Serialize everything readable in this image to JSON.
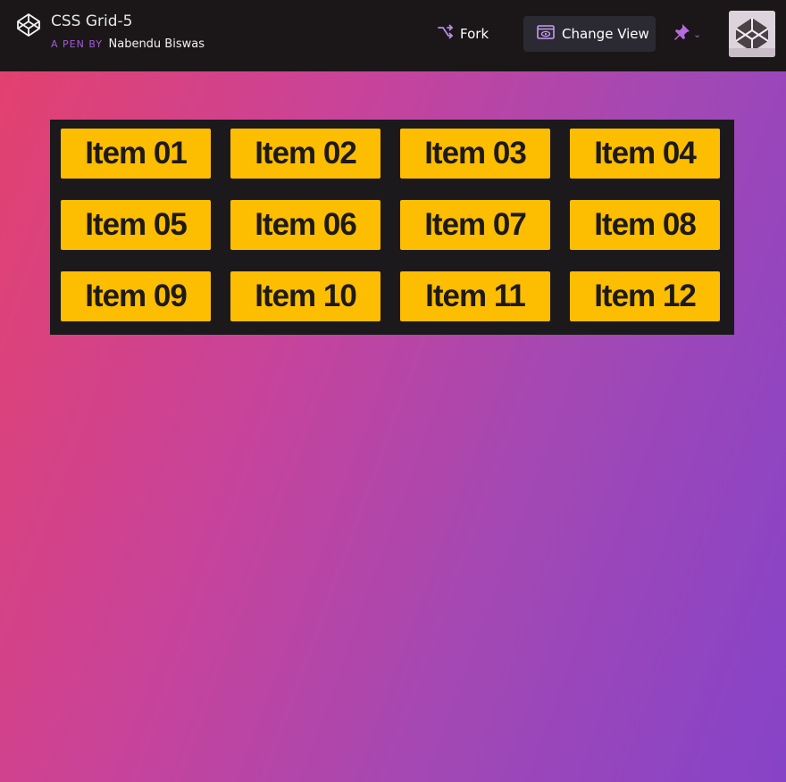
{
  "header": {
    "pen_title": "CSS Grid-5",
    "byline_prefix": "A PEN BY",
    "author": "Nabendu Biswas",
    "fork_label": "Fork",
    "change_view_label": "Change View",
    "logo_icon": "codepen-logo-icon",
    "fork_icon": "fork-icon",
    "change_view_icon": "view-icon",
    "pin_icon": "pin-icon"
  },
  "colors": {
    "header_bg": "#1b1718",
    "accent_purple": "#a45bd6",
    "grid_bg": "#1b191b",
    "item_bg": "#fdbd00",
    "item_text": "#1d1a17",
    "gradient_start": "#e3416f",
    "gradient_end": "#8643c8"
  },
  "grid": {
    "items": [
      "Item 01",
      "Item 02",
      "Item 03",
      "Item 04",
      "Item 05",
      "Item 06",
      "Item 07",
      "Item 08",
      "Item 09",
      "Item 10",
      "Item 11",
      "Item 12"
    ]
  }
}
